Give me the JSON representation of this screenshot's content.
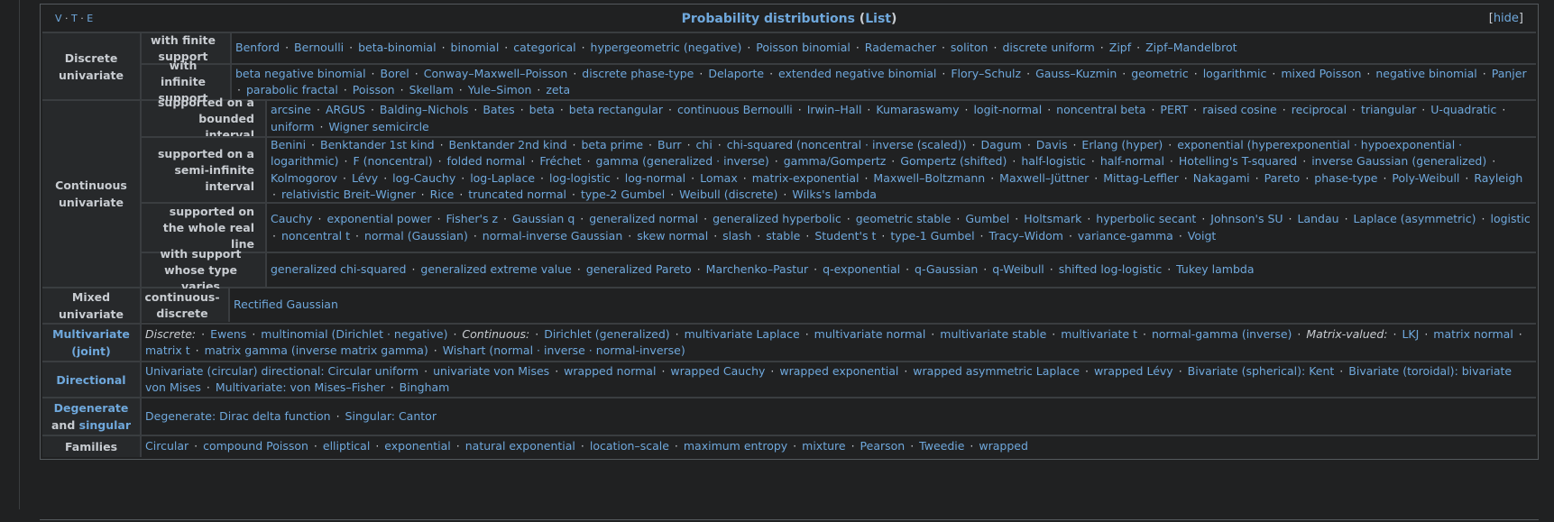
{
  "navbox": {
    "vte": [
      "V",
      "T",
      "E"
    ],
    "title": "Probability distributions",
    "title_link": "List",
    "hide": "hide"
  },
  "groups": [
    {
      "label": "Discrete univariate",
      "rows": [
        {
          "label": "with finite support",
          "items": [
            "Benford",
            "Bernoulli",
            "beta-binomial",
            "binomial",
            "categorical",
            "hypergeometric (negative)",
            "Poisson binomial",
            "Rademacher",
            "soliton",
            "discrete uniform",
            "Zipf",
            "Zipf–Mandelbrot"
          ]
        },
        {
          "label": "with infinite support",
          "items": [
            "beta negative binomial",
            "Borel",
            "Conway–Maxwell–Poisson",
            "discrete phase-type",
            "Delaporte",
            "extended negative binomial",
            "Flory–Schulz",
            "Gauss–Kuzmin",
            "geometric",
            "logarithmic",
            "mixed Poisson",
            "negative binomial",
            "Panjer",
            "parabolic fractal",
            "Poisson",
            "Skellam",
            "Yule–Simon",
            "zeta"
          ]
        }
      ]
    },
    {
      "label": "Continuous univariate",
      "rows": [
        {
          "label": "supported on a bounded interval",
          "items": [
            "arcsine",
            "ARGUS",
            "Balding–Nichols",
            "Bates",
            "beta",
            "beta rectangular",
            "continuous Bernoulli",
            "Irwin–Hall",
            "Kumaraswamy",
            "logit-normal",
            "noncentral beta",
            "PERT",
            "raised cosine",
            "reciprocal",
            "triangular",
            "U-quadratic",
            "uniform",
            "Wigner semicircle"
          ]
        },
        {
          "label": "supported on a semi-infinite interval",
          "items": [
            "Benini",
            "Benktander 1st kind",
            "Benktander 2nd kind",
            "beta prime",
            "Burr",
            "chi",
            "chi-squared (noncentral · inverse (scaled))",
            "Dagum",
            "Davis",
            "Erlang (hyper)",
            "exponential (hyperexponential · hypoexponential · logarithmic)",
            "F (noncentral)",
            "folded normal",
            "Fréchet",
            "gamma (generalized · inverse)",
            "gamma/Gompertz",
            "Gompertz (shifted)",
            "half-logistic",
            "half-normal",
            "Hotelling's T-squared",
            "inverse Gaussian (generalized)",
            "Kolmogorov",
            "Lévy",
            "log-Cauchy",
            "log-Laplace",
            "log-logistic",
            "log-normal",
            "Lomax",
            "matrix-exponential",
            "Maxwell–Boltzmann",
            "Maxwell–Jüttner",
            "Mittag-Leffler",
            "Nakagami",
            "Pareto",
            "phase-type",
            "Poly-Weibull",
            "Rayleigh",
            "relativistic Breit–Wigner",
            "Rice",
            "truncated normal",
            "type-2 Gumbel",
            "Weibull (discrete)",
            "Wilks's lambda"
          ]
        },
        {
          "label": "supported on the whole real line",
          "items": [
            "Cauchy",
            "exponential power",
            "Fisher's z",
            "Gaussian q",
            "generalized normal",
            "generalized hyperbolic",
            "geometric stable",
            "Gumbel",
            "Holtsmark",
            "hyperbolic secant",
            "Johnson's SU",
            "Landau",
            "Laplace (asymmetric)",
            "logistic",
            "noncentral t",
            "normal (Gaussian)",
            "normal-inverse Gaussian",
            "skew normal",
            "slash",
            "stable",
            "Student's t",
            "type-1 Gumbel",
            "Tracy–Widom",
            "variance-gamma",
            "Voigt"
          ]
        },
        {
          "label": "with support whose type varies",
          "items": [
            "generalized chi-squared",
            "generalized extreme value",
            "generalized Pareto",
            "Marchenko–Pastur",
            "q-exponential",
            "q-Gaussian",
            "q-Weibull",
            "shifted log-logistic",
            "Tukey lambda"
          ]
        }
      ]
    },
    {
      "label": "Mixed univariate",
      "rows": [
        {
          "label": "continuous-discrete",
          "items": [
            "Rectified Gaussian"
          ]
        }
      ]
    }
  ],
  "multivariate": {
    "label": "Multivariate (joint)",
    "text": [
      "Discrete:",
      "Ewens",
      "multinomial (Dirichlet · negative)",
      "Continuous:",
      "Dirichlet (generalized)",
      "multivariate Laplace",
      "multivariate normal",
      "multivariate stable",
      "multivariate t",
      "normal-gamma (inverse)",
      "Matrix-valued:",
      "LKJ",
      "matrix normal",
      "matrix t",
      "matrix gamma (inverse matrix gamma)",
      "Wishart (normal · inverse · normal-inverse)"
    ]
  },
  "directional": {
    "label": "Directional",
    "text": [
      "Univariate (circular) directional: Circular uniform",
      "univariate von Mises",
      "wrapped normal",
      "wrapped Cauchy",
      "wrapped exponential",
      "wrapped asymmetric Laplace",
      "wrapped Lévy",
      "Bivariate (spherical): Kent",
      "Bivariate (toroidal): bivariate von Mises",
      "Multivariate: von Mises–Fisher",
      "Bingham"
    ]
  },
  "degenerate": {
    "label_1": "Degenerate",
    "label_and": "and",
    "label_2": "singular",
    "text": [
      "Degenerate: Dirac delta function",
      "Singular: Cantor"
    ]
  },
  "families": {
    "label": "Families",
    "items": [
      "Circular",
      "compound Poisson",
      "elliptical",
      "exponential",
      "natural exponential",
      "location–scale",
      "maximum entropy",
      "mixture",
      "Pearson",
      "Tweedie",
      "wrapped"
    ]
  }
}
